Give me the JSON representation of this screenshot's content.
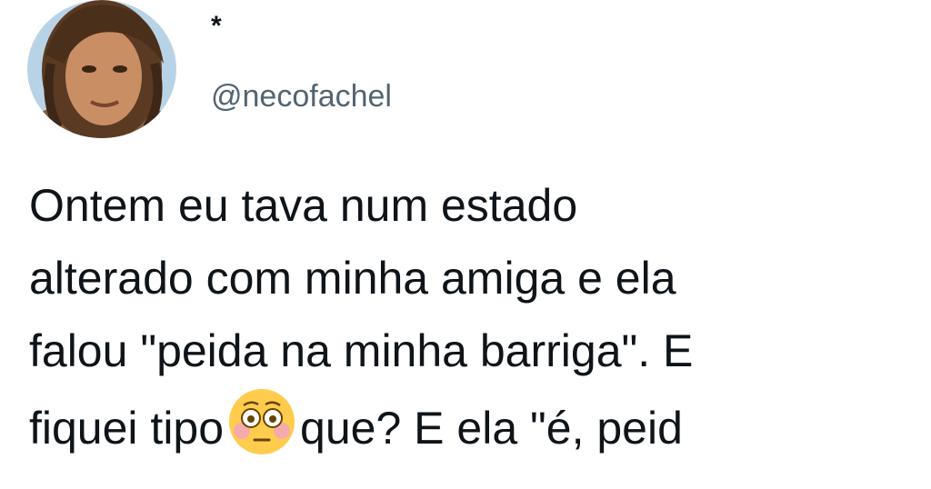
{
  "author": {
    "display_name": "*",
    "handle": "@necofachel",
    "avatar_icon": "profile-photo"
  },
  "tweet": {
    "lines": [
      "Ontem eu tava num estado",
      "alterado com minha amiga e ela",
      "falou \"peida na minha barriga\". E",
      "fiquei tipo",
      "que? E ela \"é, peid"
    ],
    "emoji": "flushed-face-icon"
  },
  "colors": {
    "background": "#ffffff",
    "text": "#0f1419",
    "handle": "#536471"
  }
}
